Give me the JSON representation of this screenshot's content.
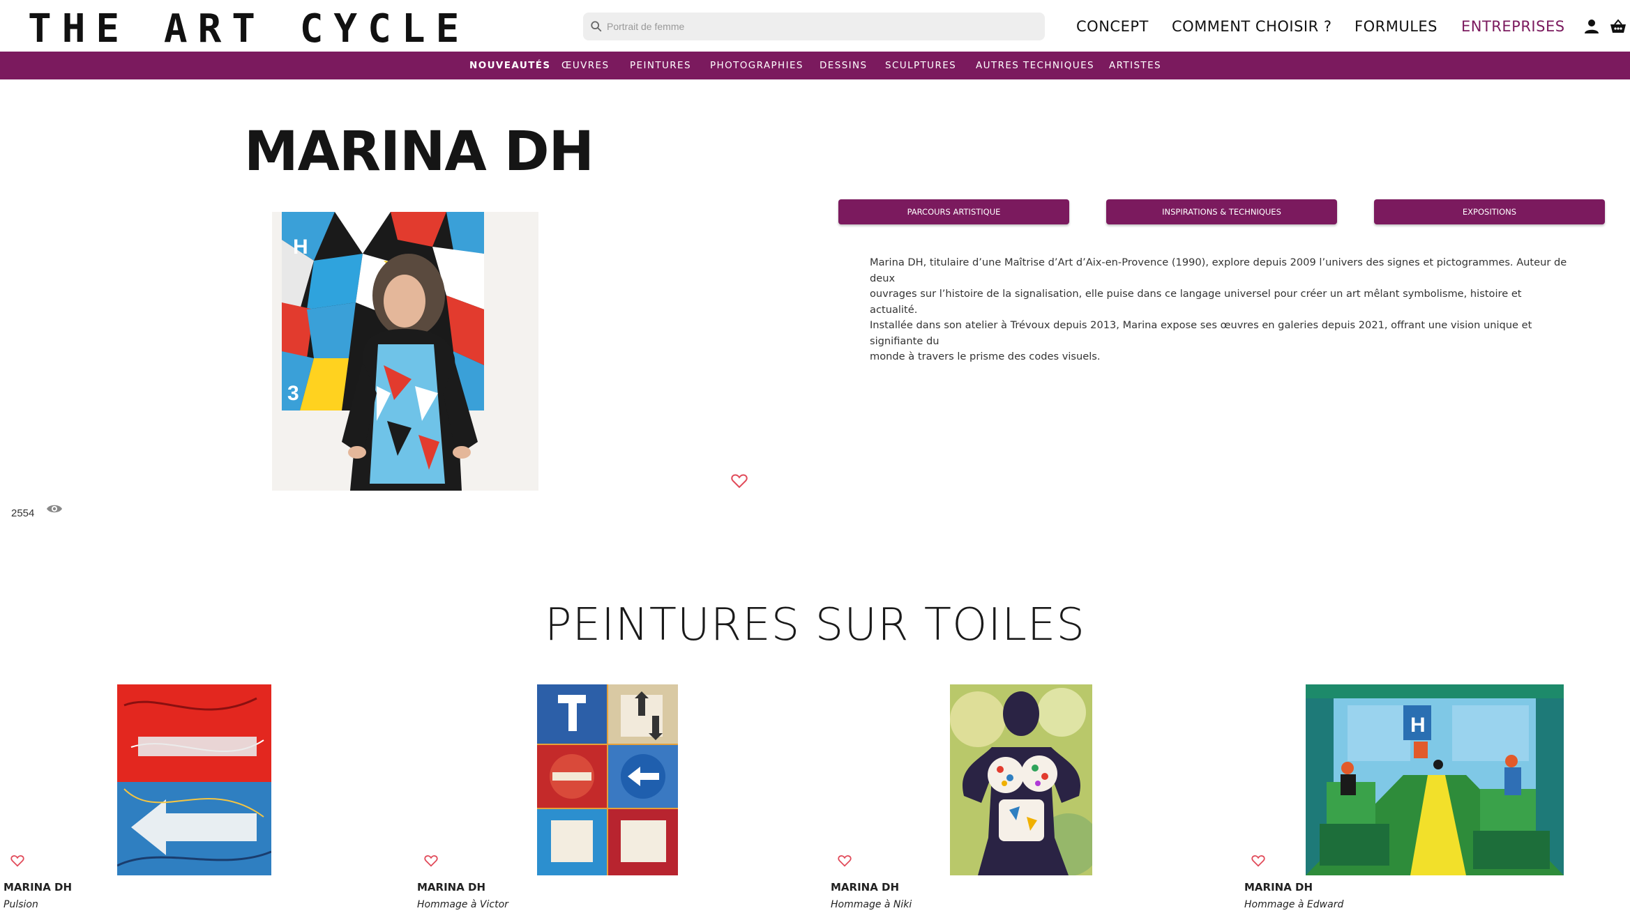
{
  "header": {
    "logo": "THE ART CYCLE",
    "search_placeholder": "Portrait de femme",
    "nav": [
      "CONCEPT",
      "COMMENT CHOISIR ?",
      "FORMULES",
      "ENTREPRISES"
    ],
    "accent_color": "#7b1a5e",
    "icons": [
      "search-icon",
      "user-icon",
      "basket-icon"
    ]
  },
  "categories": [
    "NOUVEAUTÉS",
    "ŒUVRES",
    "PEINTURES",
    "PHOTOGRAPHIES",
    "DESSINS",
    "SCULPTURES",
    "AUTRES TECHNIQUES",
    "ARTISTES"
  ],
  "artist": {
    "name": "MARINA DH",
    "views": "2554",
    "tabs": [
      "PARCOURS ARTISTIQUE",
      "INSPIRATIONS & TECHNIQUES",
      "EXPOSITIONS"
    ],
    "bio": [
      "Marina DH, titulaire d’une Maîtrise d’Art d’Aix-en-Provence (1990), explore depuis 2009 l’univers des signes et pictogrammes. Auteur de deux",
      "ouvrages sur l’histoire de la signalisation, elle puise dans ce langage universel pour créer un art mêlant symbolisme, histoire et actualité.",
      "Installée dans son atelier à Trévoux depuis 2013, Marina expose ses œuvres en galeries depuis 2021, offrant une vision unique et signifiante du",
      "monde à travers le prisme des codes visuels."
    ]
  },
  "section": {
    "title": "PEINTURES SUR TOILES",
    "artworks": [
      {
        "artist": "MARINA DH",
        "title": "Pulsion"
      },
      {
        "artist": "MARINA DH",
        "title": "Hommage à Victor"
      },
      {
        "artist": "MARINA DH",
        "title": "Hommage à Niki"
      },
      {
        "artist": "MARINA DH",
        "title": "Hommage à Edward"
      }
    ]
  }
}
